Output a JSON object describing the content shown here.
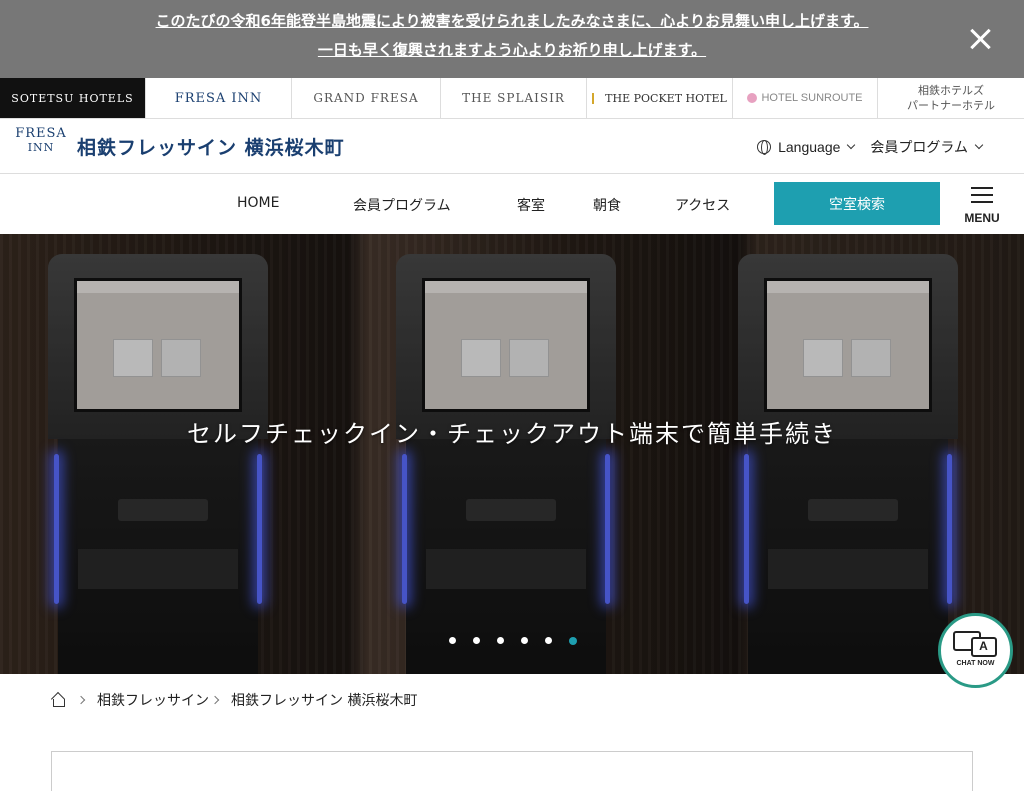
{
  "notice": {
    "line1": "このたびの令和6年能登半島地震により被害を受けられましたみなさまに、心よりお見舞い申し上げます。",
    "line2": "一日も早く復興されますよう心よりお祈り申し上げます。"
  },
  "brands": [
    {
      "label": "SOTETSU HOTELS"
    },
    {
      "label": "FRESA INN"
    },
    {
      "label": "GRAND FRESA"
    },
    {
      "label": "THE SPLAISIR"
    },
    {
      "label": "THE POCKET HOTEL"
    },
    {
      "label": "HOTEL SUNROUTE"
    },
    {
      "label": "相鉄ホテルズ\nパートナーホテル"
    }
  ],
  "header": {
    "logo_mark_top": "FRESA",
    "logo_mark_bottom": "INN",
    "hotel_name": "相鉄フレッサイン 横浜桜木町",
    "language_label": "Language",
    "member_label": "会員プログラム"
  },
  "nav": {
    "items": [
      "HOME",
      "会員プログラム",
      "客室",
      "朝食",
      "アクセス"
    ],
    "search_button": "空室検索",
    "menu_label": "MENU"
  },
  "hero": {
    "caption": "セルフチェックイン・チェックアウト端末で簡単手続き",
    "slide_count": 6,
    "active_slide": 6
  },
  "chat": {
    "badge_letter": "A",
    "label": "CHAT NOW"
  },
  "breadcrumb": {
    "items": [
      "相鉄フレッサイン",
      "相鉄フレッサイン 横浜桜木町"
    ]
  },
  "colors": {
    "accent": "#1e9fb0",
    "notice_bg": "#777777",
    "brand_navy": "#1a3f70"
  }
}
